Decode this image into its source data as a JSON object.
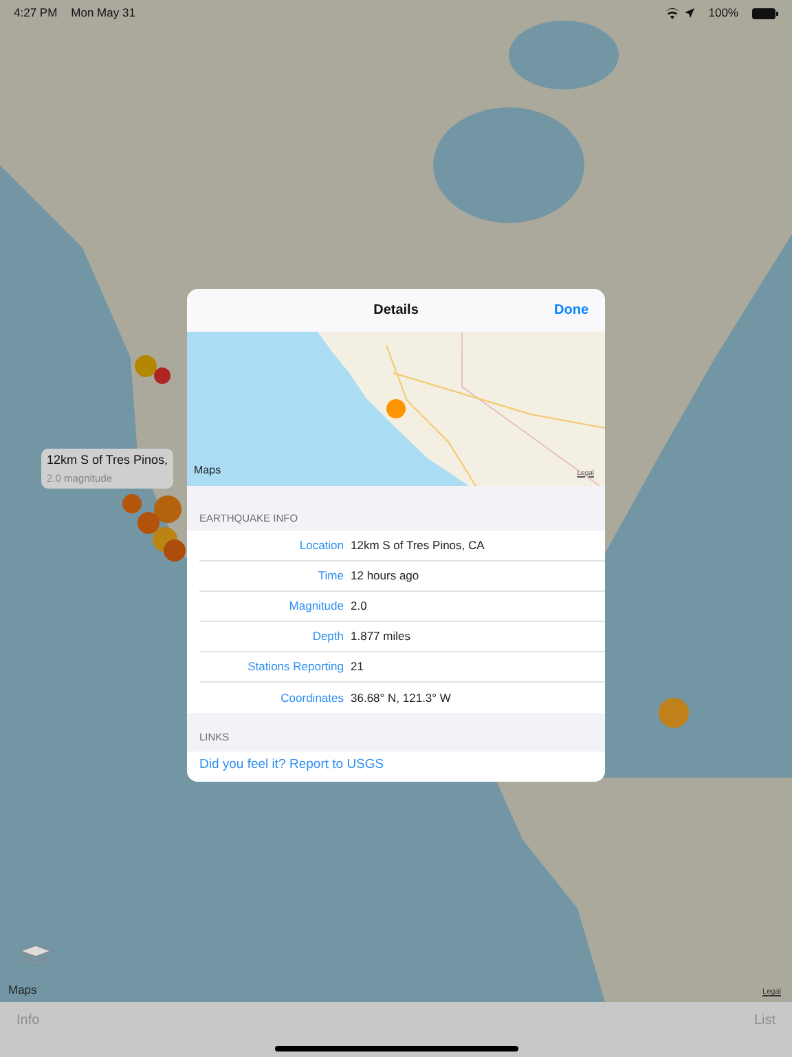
{
  "status_bar": {
    "time": "4:27 PM",
    "date": "Mon May 31",
    "battery": "100%"
  },
  "map": {
    "attribution": "Maps",
    "legal": "Legal",
    "markers": [
      {
        "color": "#b48700"
      },
      {
        "color": "#ae2622"
      },
      {
        "color": "#b4550c"
      },
      {
        "color": "#b4620c"
      },
      {
        "color": "#b4510a"
      },
      {
        "color": "#ba8312"
      },
      {
        "color": "#ad4d0c"
      },
      {
        "color": "#c0801a"
      }
    ],
    "callout": {
      "title": "12km S of Tres Pinos,",
      "subtitle": "2.0 magnitude"
    }
  },
  "details": {
    "title": "Details",
    "done": "Done",
    "map": {
      "attribution": "Maps",
      "legal": "Legal",
      "marker": {
        "color": "#ff9500"
      }
    },
    "sections": [
      {
        "kind": "info",
        "header": "EARTHQUAKE INFO",
        "rows": [
          {
            "label": "Location",
            "value": "12km S of Tres Pinos, CA"
          },
          {
            "label": "Time",
            "value": "12 hours ago"
          },
          {
            "label": "Magnitude",
            "value": "2.0"
          },
          {
            "label": "Depth",
            "value": "1.877 miles"
          },
          {
            "label": "Stations Reporting",
            "value": "21"
          },
          {
            "label": "Coordinates",
            "value": "36.68° N, 121.3° W"
          }
        ]
      },
      {
        "kind": "links",
        "header": "LINKS",
        "links": [
          "Did you feel it? Report to USGS"
        ]
      }
    ]
  },
  "toolbar": {
    "left": "Info",
    "right": "List"
  }
}
